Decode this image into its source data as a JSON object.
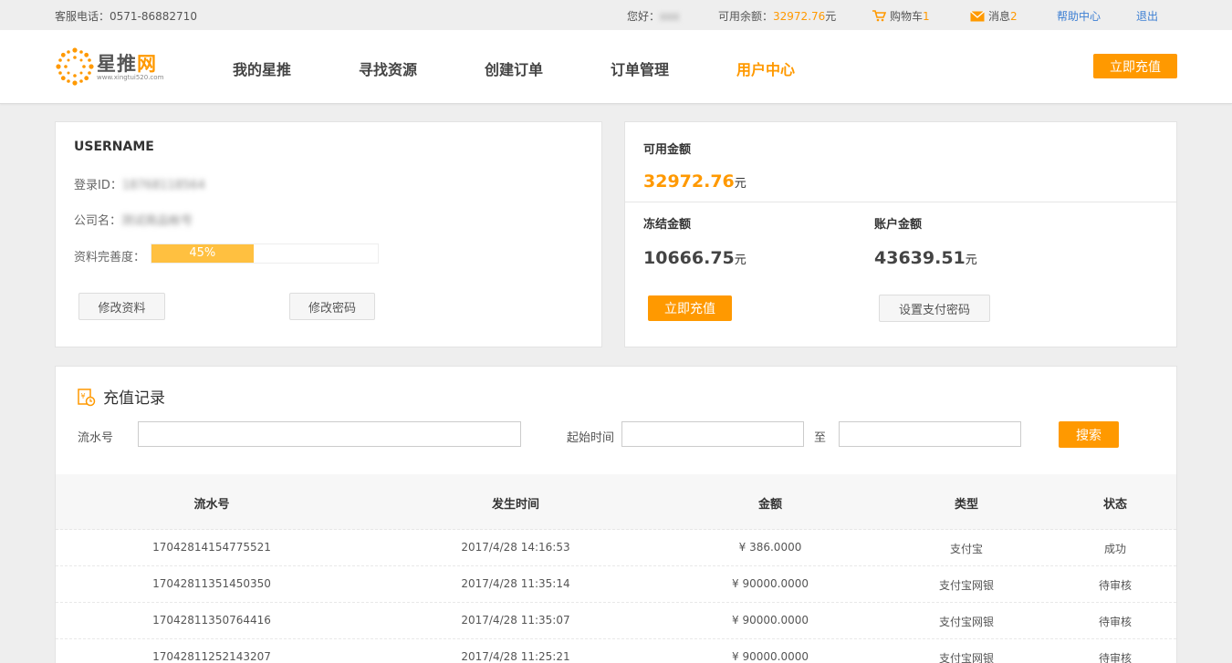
{
  "topbar": {
    "hotline": "客服电话：0571-86882710",
    "greeting_label": "您好：",
    "greeting_user": "xxx",
    "balance_label": "可用余额：",
    "balance_value": "32972.76",
    "balance_unit": "元",
    "cart_label": "购物车",
    "cart_count": "1",
    "msg_label": "消息",
    "msg_count": "2",
    "help": "帮助中心",
    "logout": "退出"
  },
  "header": {
    "logo_text_a": "星推",
    "logo_text_b": "网",
    "logo_url": "www.xingtui520.com",
    "nav": [
      "我的星推",
      "寻找资源",
      "创建订单",
      "订单管理",
      "用户中心"
    ],
    "recharge": "立即充值"
  },
  "user_card": {
    "username": "USERNAME",
    "login_id_label": "登录ID：",
    "login_id_value": "18768118564",
    "company_label": "公司名：",
    "company_value": "测试商品帐号",
    "completeness_label": "资料完善度：",
    "completeness_percent": 45,
    "completeness_text": "45%",
    "edit_profile": "修改资料",
    "edit_password": "修改密码"
  },
  "balance_card": {
    "available_label": "可用金额",
    "available_value": "32972.76",
    "frozen_label": "冻结金额",
    "frozen_value": "10666.75",
    "account_label": "账户金额",
    "account_value": "43639.51",
    "unit": "元",
    "recharge": "立即充值",
    "set_pay_password": "设置支付密码",
    "accent_color": "#ff9900"
  },
  "records": {
    "title": "充值记录",
    "serial_label": "流水号",
    "start_label": "起始时间",
    "to_label": "至",
    "serial_value": "",
    "start_value": "",
    "end_value": "",
    "search": "搜索",
    "columns": [
      "流水号",
      "发生时间",
      "金额",
      "类型",
      "状态"
    ],
    "rows": [
      [
        "17042814154775521",
        "2017/4/28 14:16:53",
        "¥ 386.0000",
        "支付宝",
        "成功"
      ],
      [
        "17042811351450350",
        "2017/4/28 11:35:14",
        "¥ 90000.0000",
        "支付宝网银",
        "待审核"
      ],
      [
        "17042811350764416",
        "2017/4/28 11:35:07",
        "¥ 90000.0000",
        "支付宝网银",
        "待审核"
      ],
      [
        "17042811252143207",
        "2017/4/28 11:25:21",
        "¥ 90000.0000",
        "支付宝网银",
        "待审核"
      ]
    ]
  }
}
